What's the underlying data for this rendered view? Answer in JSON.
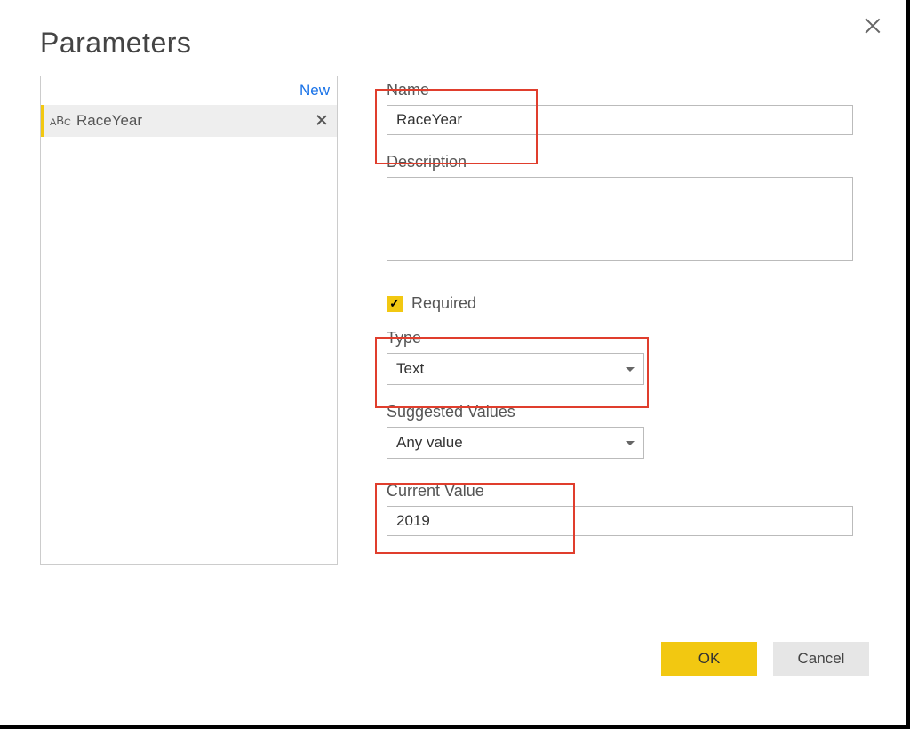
{
  "dialog": {
    "title": "Parameters",
    "newLink": "New",
    "parameters": [
      {
        "typeGlyph": "ABC",
        "name": "RaceYear"
      }
    ]
  },
  "form": {
    "nameLabel": "Name",
    "nameValue": "RaceYear",
    "descriptionLabel": "Description",
    "descriptionValue": "",
    "requiredLabel": "Required",
    "requiredChecked": true,
    "typeLabel": "Type",
    "typeValue": "Text",
    "suggestedLabel": "Suggested Values",
    "suggestedValue": "Any value",
    "currentValueLabel": "Current Value",
    "currentValue": "2019"
  },
  "buttons": {
    "ok": "OK",
    "cancel": "Cancel"
  }
}
